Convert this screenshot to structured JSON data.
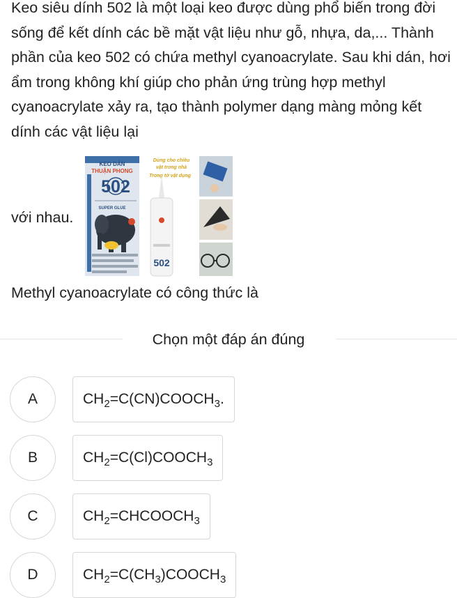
{
  "question": {
    "paragraph": "Keo siêu dính 502 là một loại keo được dùng phổ biến trong đời sống để kết dính các bề mặt vật liệu như gỗ, nhựa, da,... Thành phần của keo 502 có chứa methyl cyanoacrylate. Sau khi dán, hơi ẩm trong không khí giúp cho phản ứng trùng hợp methyl cyanoacrylate xảy ra, tạo thành polymer dạng màng mỏng kết dính các vật liệu lại",
    "with_image_label": "với nhau.",
    "product_box_text": {
      "brand_top": "KEO DÁN",
      "brand_name": "THUẬN PHONG",
      "number": "502",
      "super_glue": "SUPER GLUE",
      "tube_number": "502",
      "stamp_line1": "Dùng cho chiều",
      "stamp_line2": "vật trong nhà",
      "stamp_line3": "Trong tờ vật dụng"
    },
    "prompt": "Methyl cyanoacrylate có công thức là"
  },
  "instruction": "Chọn một đáp án đúng",
  "options": [
    {
      "letter": "A",
      "formula": [
        [
          "t",
          "CH"
        ],
        [
          "s",
          "2"
        ],
        [
          "t",
          "=C(CN)COOCH"
        ],
        [
          "s",
          "3"
        ],
        [
          "t",
          "."
        ]
      ]
    },
    {
      "letter": "B",
      "formula": [
        [
          "t",
          "CH"
        ],
        [
          "s",
          "2"
        ],
        [
          "t",
          "=C(Cl)COOCH"
        ],
        [
          "s",
          "3"
        ]
      ]
    },
    {
      "letter": "C",
      "formula": [
        [
          "t",
          "CH"
        ],
        [
          "s",
          "2"
        ],
        [
          "t",
          "=CHCOOCH"
        ],
        [
          "s",
          "3"
        ]
      ]
    },
    {
      "letter": "D",
      "formula": [
        [
          "t",
          "CH"
        ],
        [
          "s",
          "2"
        ],
        [
          "t",
          "=C(CH"
        ],
        [
          "s",
          "3"
        ],
        [
          "t",
          ")COOCH"
        ],
        [
          "s",
          "3"
        ]
      ]
    }
  ],
  "colors": {
    "text": "#222222",
    "border": "#d6d6d6",
    "box_blue": "#3e6fa6",
    "elephant": "#2f3640",
    "tube_white": "#f4f4f4",
    "cap_white": "#e8e8e8",
    "accent_red": "#d64a2b",
    "accent_yellow": "#f1c232"
  }
}
